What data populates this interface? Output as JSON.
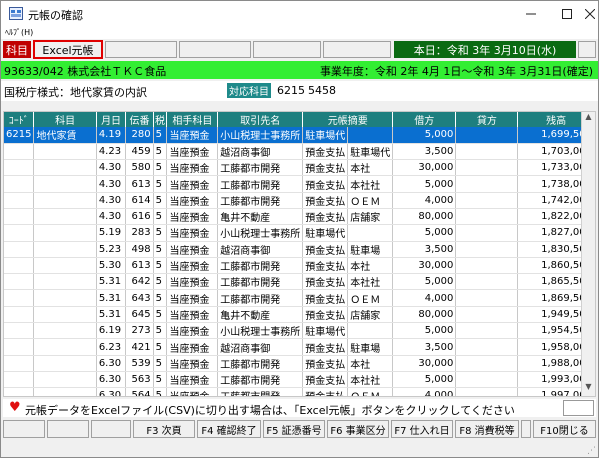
{
  "window": {
    "title": "元帳の確認"
  },
  "menu": {
    "help": "ﾍﾙﾌﾟ(H)"
  },
  "tabs": {
    "kamoku": "科目",
    "excel": "Excel元帳"
  },
  "today": "本日：令和 3年 3月10日(水)",
  "company": "93633/042 株式会社ＴＫＣ食品",
  "fiscal_year": "事業年度：令和 2年 4月 1日～令和 3年 3月31日(確定)",
  "kokuzei": "国税庁様式：地代家賃の内訳",
  "taiou": {
    "label": "対応科目",
    "code": "6215",
    "code2": "5458"
  },
  "columns": [
    "ｺｰﾄﾞ",
    "科目",
    "月日",
    "伝番",
    "税",
    "相手科目",
    "取引先名",
    "元帳摘要",
    "借方",
    "貸方",
    "残高"
  ],
  "rows": [
    [
      "6215",
      "地代家賃",
      "4.19",
      "280",
      "5",
      "当座預金",
      "小山税理士事務所",
      "駐車場代",
      "",
      "5,000",
      "",
      "1,699,500"
    ],
    [
      "",
      "",
      "4.23",
      "459",
      "5",
      "当座預金",
      "越沼商事御",
      "預金支払",
      "駐車場代",
      "3,500",
      "",
      "1,703,000"
    ],
    [
      "",
      "",
      "4.30",
      "580",
      "5",
      "当座預金",
      "工藤都市開発",
      "預金支払",
      "本社",
      "30,000",
      "",
      "1,733,000"
    ],
    [
      "",
      "",
      "4.30",
      "613",
      "5",
      "当座預金",
      "工藤都市開発",
      "預金支払",
      "本社社",
      "5,000",
      "",
      "1,738,000"
    ],
    [
      "",
      "",
      "4.30",
      "614",
      "5",
      "当座預金",
      "工藤都市開発",
      "預金支払",
      "ＯＥＭ",
      "4,000",
      "",
      "1,742,000"
    ],
    [
      "",
      "",
      "4.30",
      "616",
      "5",
      "当座預金",
      "亀井不動産",
      "預金支払",
      "店舗家",
      "80,000",
      "",
      "1,822,000"
    ],
    [
      "",
      "",
      "5.19",
      "283",
      "5",
      "当座預金",
      "小山税理士事務所",
      "駐車場代",
      "",
      "5,000",
      "",
      "1,827,000"
    ],
    [
      "",
      "",
      "5.23",
      "498",
      "5",
      "当座預金",
      "越沼商事御",
      "預金支払",
      "駐車場",
      "3,500",
      "",
      "1,830,500"
    ],
    [
      "",
      "",
      "5.30",
      "613",
      "5",
      "当座預金",
      "工藤都市開発",
      "預金支払",
      "本社",
      "30,000",
      "",
      "1,860,500"
    ],
    [
      "",
      "",
      "5.31",
      "642",
      "5",
      "当座預金",
      "工藤都市開発",
      "預金支払",
      "本社社",
      "5,000",
      "",
      "1,865,500"
    ],
    [
      "",
      "",
      "5.31",
      "643",
      "5",
      "当座預金",
      "工藤都市開発",
      "預金支払",
      "ＯＥＭ",
      "4,000",
      "",
      "1,869,500"
    ],
    [
      "",
      "",
      "5.31",
      "645",
      "5",
      "当座預金",
      "亀井不動産",
      "預金支払",
      "店舗家",
      "80,000",
      "",
      "1,949,500"
    ],
    [
      "",
      "",
      "6.19",
      "273",
      "5",
      "当座預金",
      "小山税理士事務所",
      "駐車場代",
      "",
      "5,000",
      "",
      "1,954,500"
    ],
    [
      "",
      "",
      "6.23",
      "421",
      "5",
      "当座預金",
      "越沼商事御",
      "預金支払",
      "駐車場",
      "3,500",
      "",
      "1,958,000"
    ],
    [
      "",
      "",
      "6.30",
      "539",
      "5",
      "当座預金",
      "工藤都市開発",
      "預金支払",
      "本社",
      "30,000",
      "",
      "1,988,000"
    ],
    [
      "",
      "",
      "6.30",
      "563",
      "5",
      "当座預金",
      "工藤都市開発",
      "預金支払",
      "本社社",
      "5,000",
      "",
      "1,993,000"
    ],
    [
      "",
      "",
      "6.30",
      "564",
      "5",
      "当座預金",
      "工藤都市開発",
      "預金支払",
      "ＯＥＭ",
      "4,000",
      "",
      "1,997,000"
    ]
  ],
  "hint": "元帳データをExcelファイル(CSV)に切り出す場合は、「Excel元帳」ボタンをクリックしてください",
  "fkeys": [
    "",
    "",
    "",
    "F3 次頁",
    "F4 確認終了",
    "F5 証憑番号",
    "F6 事業区分",
    "F7 仕入れ日",
    "F8 消費税等",
    "",
    "F10閉じる"
  ],
  "colors": {
    "header_teal": "#1e7f7f",
    "selected_row": "#0a6fd0",
    "company_green": "#33ee33",
    "today_green": "#0a6a12",
    "tab_red": "#c00000"
  }
}
